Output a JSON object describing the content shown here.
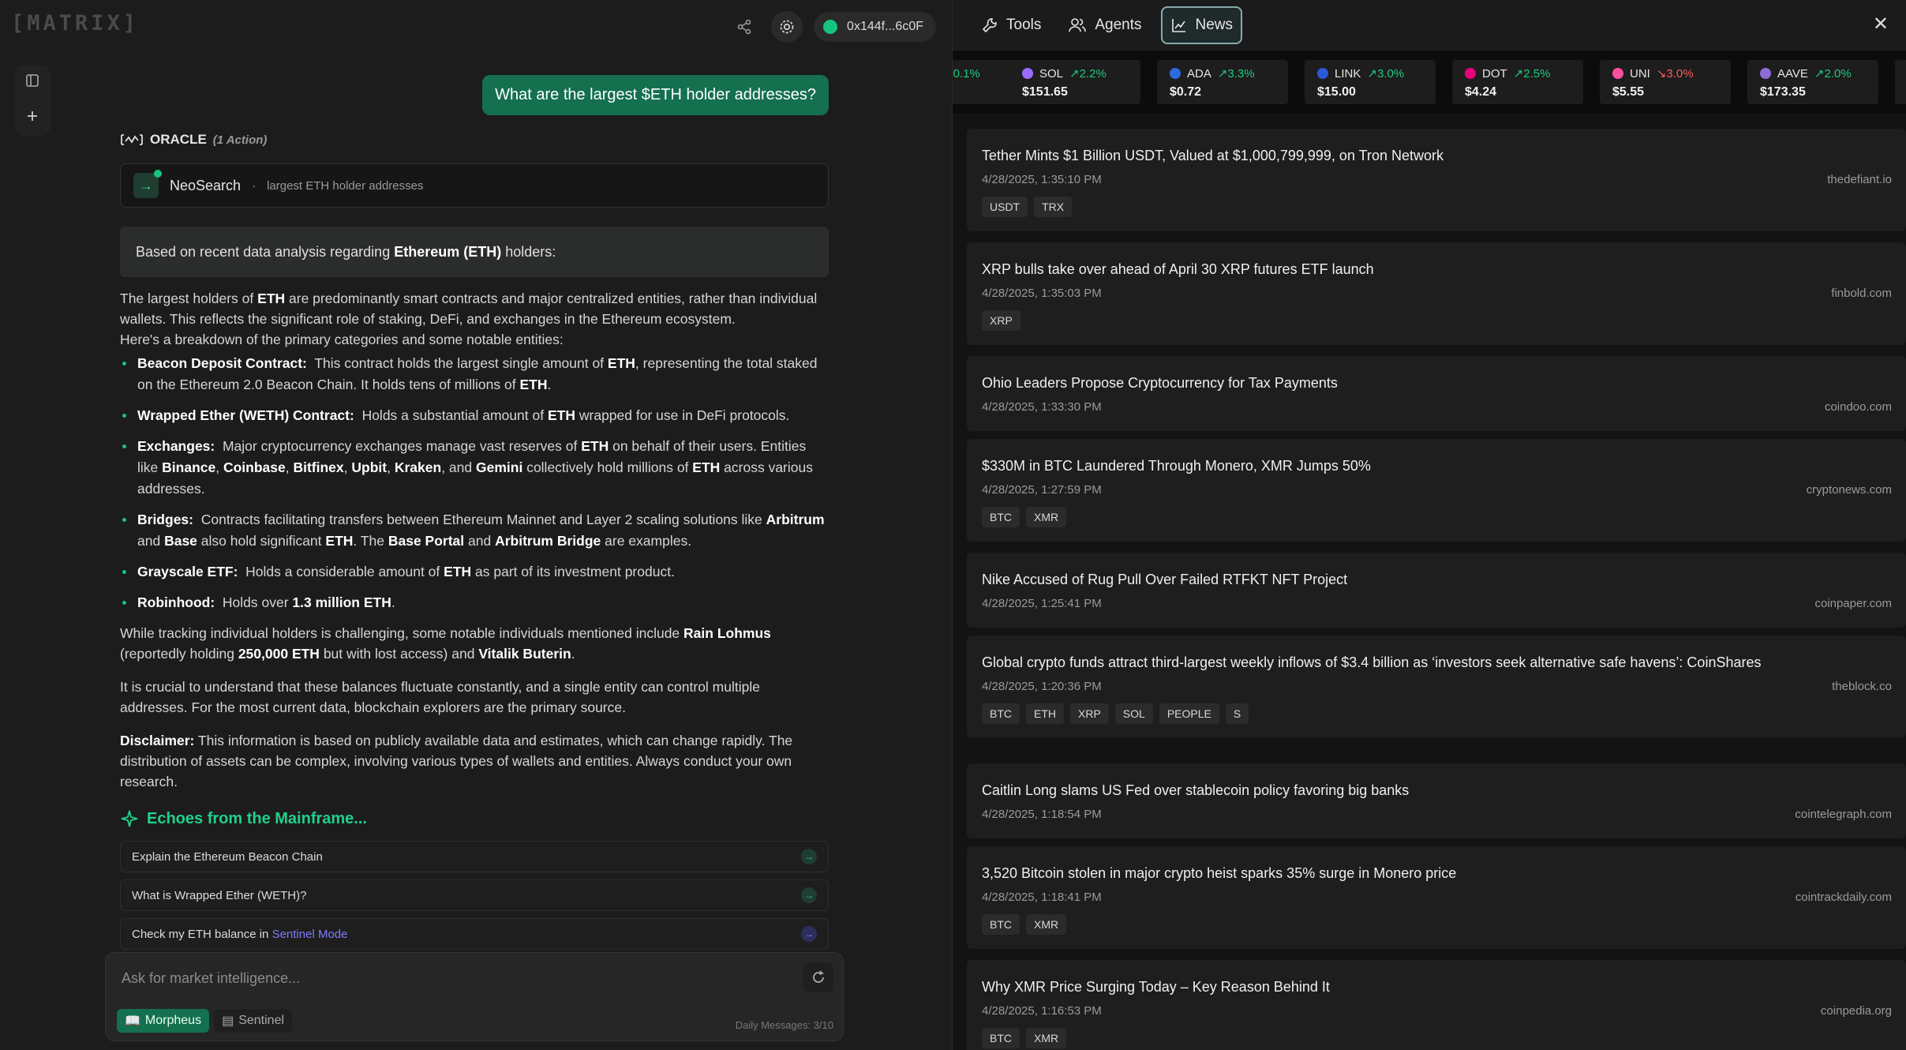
{
  "app": {
    "logo": "[MATRIX]"
  },
  "topbar": {
    "wallet": "0x144f...6c0F"
  },
  "chat": {
    "user_message": "What are the largest $ETH holder addresses?",
    "oracle_label": "ORACLE",
    "oracle_actions": "(1 Action)",
    "action_name": "NeoSearch",
    "action_query": "largest ETH holder addresses",
    "summary_prefix": "Based on recent data analysis regarding",
    "summary_bold": "Ethereum (ETH)",
    "summary_suffix": "holders:",
    "intro_a": "The largest holders of",
    "intro_eth": "ETH",
    "intro_b": "are predominantly smart contracts and major centralized entities, rather than individual wallets. This reflects the significant role of staking, DeFi, and exchanges in the Ethereum ecosystem.",
    "intro_c": "Here's a breakdown of the primary categories and some notable entities:",
    "bullets": [
      {
        "label": "Beacon Deposit Contract:",
        "t1": "This contract holds the largest single amount of",
        "b1": "ETH",
        "t2": ", representing the total staked on the Ethereum 2.0 Beacon Chain. It holds tens of millions of",
        "b2": "ETH",
        "t3": "."
      },
      {
        "label": "Wrapped Ether (WETH) Contract:",
        "t1": "Holds a substantial amount of",
        "b1": "ETH",
        "t2": "wrapped for use in DeFi protocols."
      },
      {
        "label": "Exchanges:",
        "t1": "Major cryptocurrency exchanges manage vast reserves of",
        "b1": "ETH",
        "t2": "on behalf of their users. Entities like",
        "ex1": "Binance",
        "ex2": "Coinbase",
        "ex3": "Bitfinex",
        "ex4": "Upbit",
        "ex5": "Kraken",
        "ex6": "Gemini",
        "t3": "collectively hold millions of",
        "b2": "ETH",
        "t4": "across various addresses."
      },
      {
        "label": "Bridges:",
        "t1": "Contracts facilitating transfers between Ethereum Mainnet and Layer 2 scaling solutions like",
        "b1": "Arbitrum",
        "t2": "and",
        "b2": "Base",
        "t3": "also hold significant",
        "b3": "ETH",
        "t4": ". The",
        "b4": "Base Portal",
        "t5": "and",
        "b5": "Arbitrum Bridge",
        "t6": "are examples."
      },
      {
        "label": "Grayscale ETF:",
        "t1": "Holds a considerable amount of",
        "b1": "ETH",
        "t2": "as part of its investment product."
      },
      {
        "label": "Robinhood:",
        "t1": "Holds over",
        "b1": "1.3 million ETH",
        "t2": "."
      }
    ],
    "p_individuals_a": "While tracking individual holders is challenging, some notable individuals mentioned include",
    "p_individuals_b1": "Rain Lohmus",
    "p_individuals_b": "(reportedly holding",
    "p_individuals_b2": "250,000 ETH",
    "p_individuals_c": "but with lost access) and",
    "p_individuals_b3": "Vitalik Buterin",
    "p_individuals_d": ".",
    "p_fluctuate": "It is crucial to understand that these balances fluctuate constantly, and a single entity can control multiple addresses. For the most current data, blockchain explorers are the primary source.",
    "disclaimer_label": "Disclaimer:",
    "disclaimer_text": "This information is based on publicly available data and estimates, which can change rapidly. The distribution of assets can be complex, involving various types of wallets and entities. Always conduct your own research.",
    "echoes_title": "Echoes from the Mainframe...",
    "echoes": [
      "Explain the Ethereum Beacon Chain",
      "What is Wrapped Ether (WETH)?"
    ],
    "echo3_prefix": "Check my ETH balance in",
    "echo3_link": "Sentinel Mode"
  },
  "composer": {
    "placeholder": "Ask for market intelligence...",
    "mode_morpheus": "Morpheus",
    "mode_sentinel": "Sentinel",
    "daily": "Daily Messages: 3/10"
  },
  "panel": {
    "tabs": [
      "Tools",
      "Agents",
      "News"
    ],
    "ticker": [
      {
        "symbol": "",
        "change": "0.1%",
        "price": "",
        "dir": "up",
        "color": "#888888"
      },
      {
        "symbol": "SOL",
        "change": "2.2%",
        "price": "$151.65",
        "dir": "up",
        "color": "#9b6bff"
      },
      {
        "symbol": "ADA",
        "change": "3.3%",
        "price": "$0.72",
        "dir": "up",
        "color": "#2b6be0"
      },
      {
        "symbol": "LINK",
        "change": "3.0%",
        "price": "$15.00",
        "dir": "up",
        "color": "#2a5ada"
      },
      {
        "symbol": "DOT",
        "change": "2.5%",
        "price": "$4.24",
        "dir": "up",
        "color": "#e6007a"
      },
      {
        "symbol": "UNI",
        "change": "3.0%",
        "price": "$5.55",
        "dir": "down",
        "color": "#ff4fa0"
      },
      {
        "symbol": "AAVE",
        "change": "2.0%",
        "price": "$173.35",
        "dir": "up",
        "color": "#8f6bd6"
      },
      {
        "symbol": "",
        "change": "",
        "price": "$",
        "dir": "up",
        "color": "#f2a900"
      }
    ],
    "news": [
      {
        "title": "Tether Mints $1 Billion USDT, Valued at $1,000,799,999, on Tron Network",
        "time": "4/28/2025, 1:35:10 PM",
        "source": "thedefiant.io",
        "tags": [
          "USDT",
          "TRX"
        ]
      },
      {
        "title": "XRP bulls take over ahead of April 30 XRP futures ETF launch",
        "time": "4/28/2025, 1:35:03 PM",
        "source": "finbold.com",
        "tags": [
          "XRP"
        ]
      },
      {
        "title": "Ohio Leaders Propose Cryptocurrency for Tax Payments",
        "time": "4/28/2025, 1:33:30 PM",
        "source": "coindoo.com",
        "tags": []
      },
      {
        "title": "$330M in BTC Laundered Through Monero, XMR Jumps 50%",
        "time": "4/28/2025, 1:27:59 PM",
        "source": "cryptonews.com",
        "tags": [
          "BTC",
          "XMR"
        ]
      },
      {
        "title": "Nike Accused of Rug Pull Over Failed RTFKT NFT Project",
        "time": "4/28/2025, 1:25:41 PM",
        "source": "coinpaper.com",
        "tags": []
      },
      {
        "title": "Global crypto funds attract third-largest weekly inflows of $3.4 billion as ‘investors seek alternative safe havens’: CoinShares",
        "time": "4/28/2025, 1:20:36 PM",
        "source": "theblock.co",
        "tags": [
          "BTC",
          "ETH",
          "XRP",
          "SOL",
          "PEOPLE",
          "S"
        ]
      },
      {
        "title": "Caitlin Long slams US Fed over stablecoin policy favoring big banks",
        "time": "4/28/2025, 1:18:54 PM",
        "source": "cointelegraph.com",
        "tags": []
      },
      {
        "title": "3,520 Bitcoin stolen in major crypto heist sparks 35% surge in Monero price",
        "time": "4/28/2025, 1:18:41 PM",
        "source": "cointrackdaily.com",
        "tags": [
          "BTC",
          "XMR"
        ]
      },
      {
        "title": "Why XMR Price Surging Today – Key Reason Behind It",
        "time": "4/28/2025, 1:16:53 PM",
        "source": "coinpedia.org",
        "tags": [
          "BTC",
          "XMR"
        ]
      }
    ]
  }
}
